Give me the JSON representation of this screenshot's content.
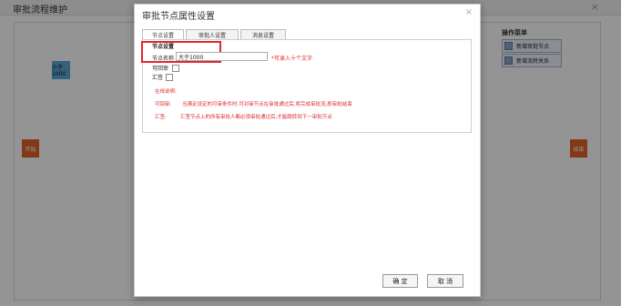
{
  "background": {
    "title": "审批流程维护",
    "close": "×",
    "nodes": {
      "less": "小于1000",
      "start": "开始",
      "end": "结束"
    },
    "op_menu": {
      "title": "操作菜单",
      "items": [
        "新增审批节点",
        "新增流转关系"
      ]
    }
  },
  "dialog": {
    "title": "审批节点属性设置",
    "close": "×",
    "tabs": [
      "节点设置",
      "审批人设置",
      "消息设置"
    ],
    "fieldset_legend": "节点设置",
    "name_label": "节点名称",
    "name_value": "大于1000",
    "hint": "*可录入十个文字",
    "sign_label": "可回审",
    "sum_label": "汇签",
    "online_title": "在线说明:",
    "notes": [
      {
        "key": "可回审:",
        "text": "当满足设定的可审条件时,可对审节点在审批通过后,将完成审批流,即审批结束"
      },
      {
        "key": "汇签:",
        "text": "汇签节点上的所有审批人都必须审批通过后,才能跳转到下一审批节点"
      }
    ],
    "ok": "确 定",
    "cancel": "取 消"
  },
  "colors": {
    "node_blue": "#5aa7d6",
    "node_orange": "#e0622a",
    "accent_red": "#e0282a"
  }
}
